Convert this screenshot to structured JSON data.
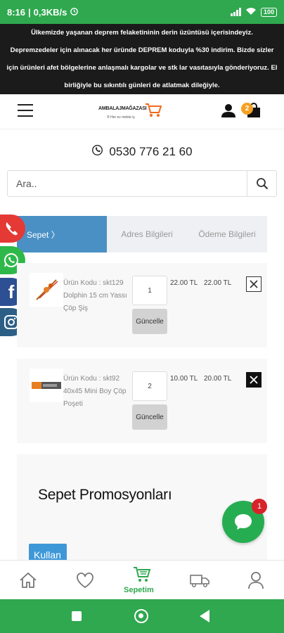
{
  "status": {
    "time": "8:16",
    "speed": "0,3KB/s",
    "battery": "100"
  },
  "announcement": {
    "lines": [
      "Ülkemizde yaşanan deprem felaketininin derin üzüntüsü içerisindeyiz.",
      "Depremzedeler için alınacak her üründe DEPREM koduyla %30 indirim. Bizde sizler",
      "için ürünleri afet bölgelerine anlaşmalı kargolar ve stk lar vasıtasıyla gönderiyoruz. El",
      "birliğiyle bu sıkıntılı günleri de atlatmak dileğiyle."
    ]
  },
  "header": {
    "logo_text": "AMBALAJMAĞAZASI",
    "logo_sub": "® Her ev mekte iş",
    "cart_count": "2"
  },
  "contact": {
    "phone": "0530 776 21 60"
  },
  "search": {
    "placeholder": "Ara.."
  },
  "steps": [
    {
      "label": "Sepet 〉"
    },
    {
      "label": "Adres Bilgileri"
    },
    {
      "label": "Ödeme Bilgileri"
    }
  ],
  "cart": {
    "items": [
      {
        "description": "Ürün Kodu : skt129 Dolphin 15 cm Yassı Çöp Şiş",
        "quantity": "1",
        "update_label": "Güncelle",
        "unit_price": "22.00 TL",
        "total_price": "22.00 TL"
      },
      {
        "description": "Ürün Kodu : skt92 40x45 Mini Boy Çöp Poşeti",
        "quantity": "2",
        "update_label": "Güncelle",
        "unit_price": "10.00 TL",
        "total_price": "20.00 TL"
      }
    ]
  },
  "promo": {
    "title": "Sepet Promosyonları",
    "apply_label": "Kullan"
  },
  "chat": {
    "badge": "1"
  },
  "bottom_nav": {
    "cart_label": "Sepetim"
  },
  "colors": {
    "brand_green": "#2fa84f",
    "step_active": "#4a90c5",
    "badge_orange": "#f5a023",
    "badge_red": "#d8232a"
  }
}
